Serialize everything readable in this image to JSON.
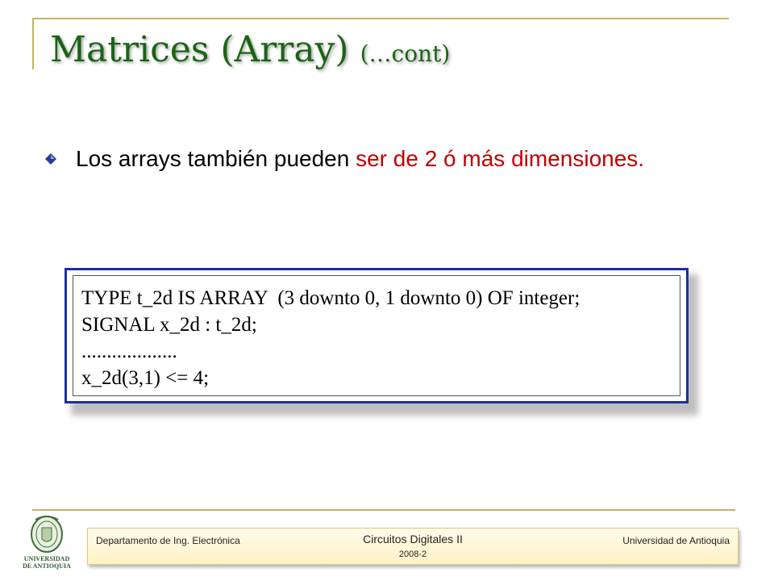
{
  "slide": {
    "title": "Matrices (Array)",
    "title_suffix": "(…cont)",
    "bullet": {
      "text_plain": "Los arrays también pueden ",
      "text_highlight": "ser de 2 ó más dimensiones."
    },
    "code_lines": [
      "TYPE t_2d IS ARRAY  (3 downto 0, 1 downto 0) OF integer;",
      "SIGNAL x_2d : t_2d;",
      "...................",
      "x_2d(3,1) <= 4;"
    ]
  },
  "footer": {
    "left": "Departamento de Ing. Electrónica",
    "center": "Circuitos Digitales II",
    "year": "2008-2",
    "right": "Universidad de Antioquia"
  },
  "logo": {
    "line1": "UNIVERSIDAD",
    "line2": "DE ANTIOQUIA",
    "icon": "university-seal-icon"
  },
  "colors": {
    "title": "#1a6414",
    "highlight": "#c00000",
    "code_border": "#1c2f9e",
    "rule": "#c8b360"
  }
}
